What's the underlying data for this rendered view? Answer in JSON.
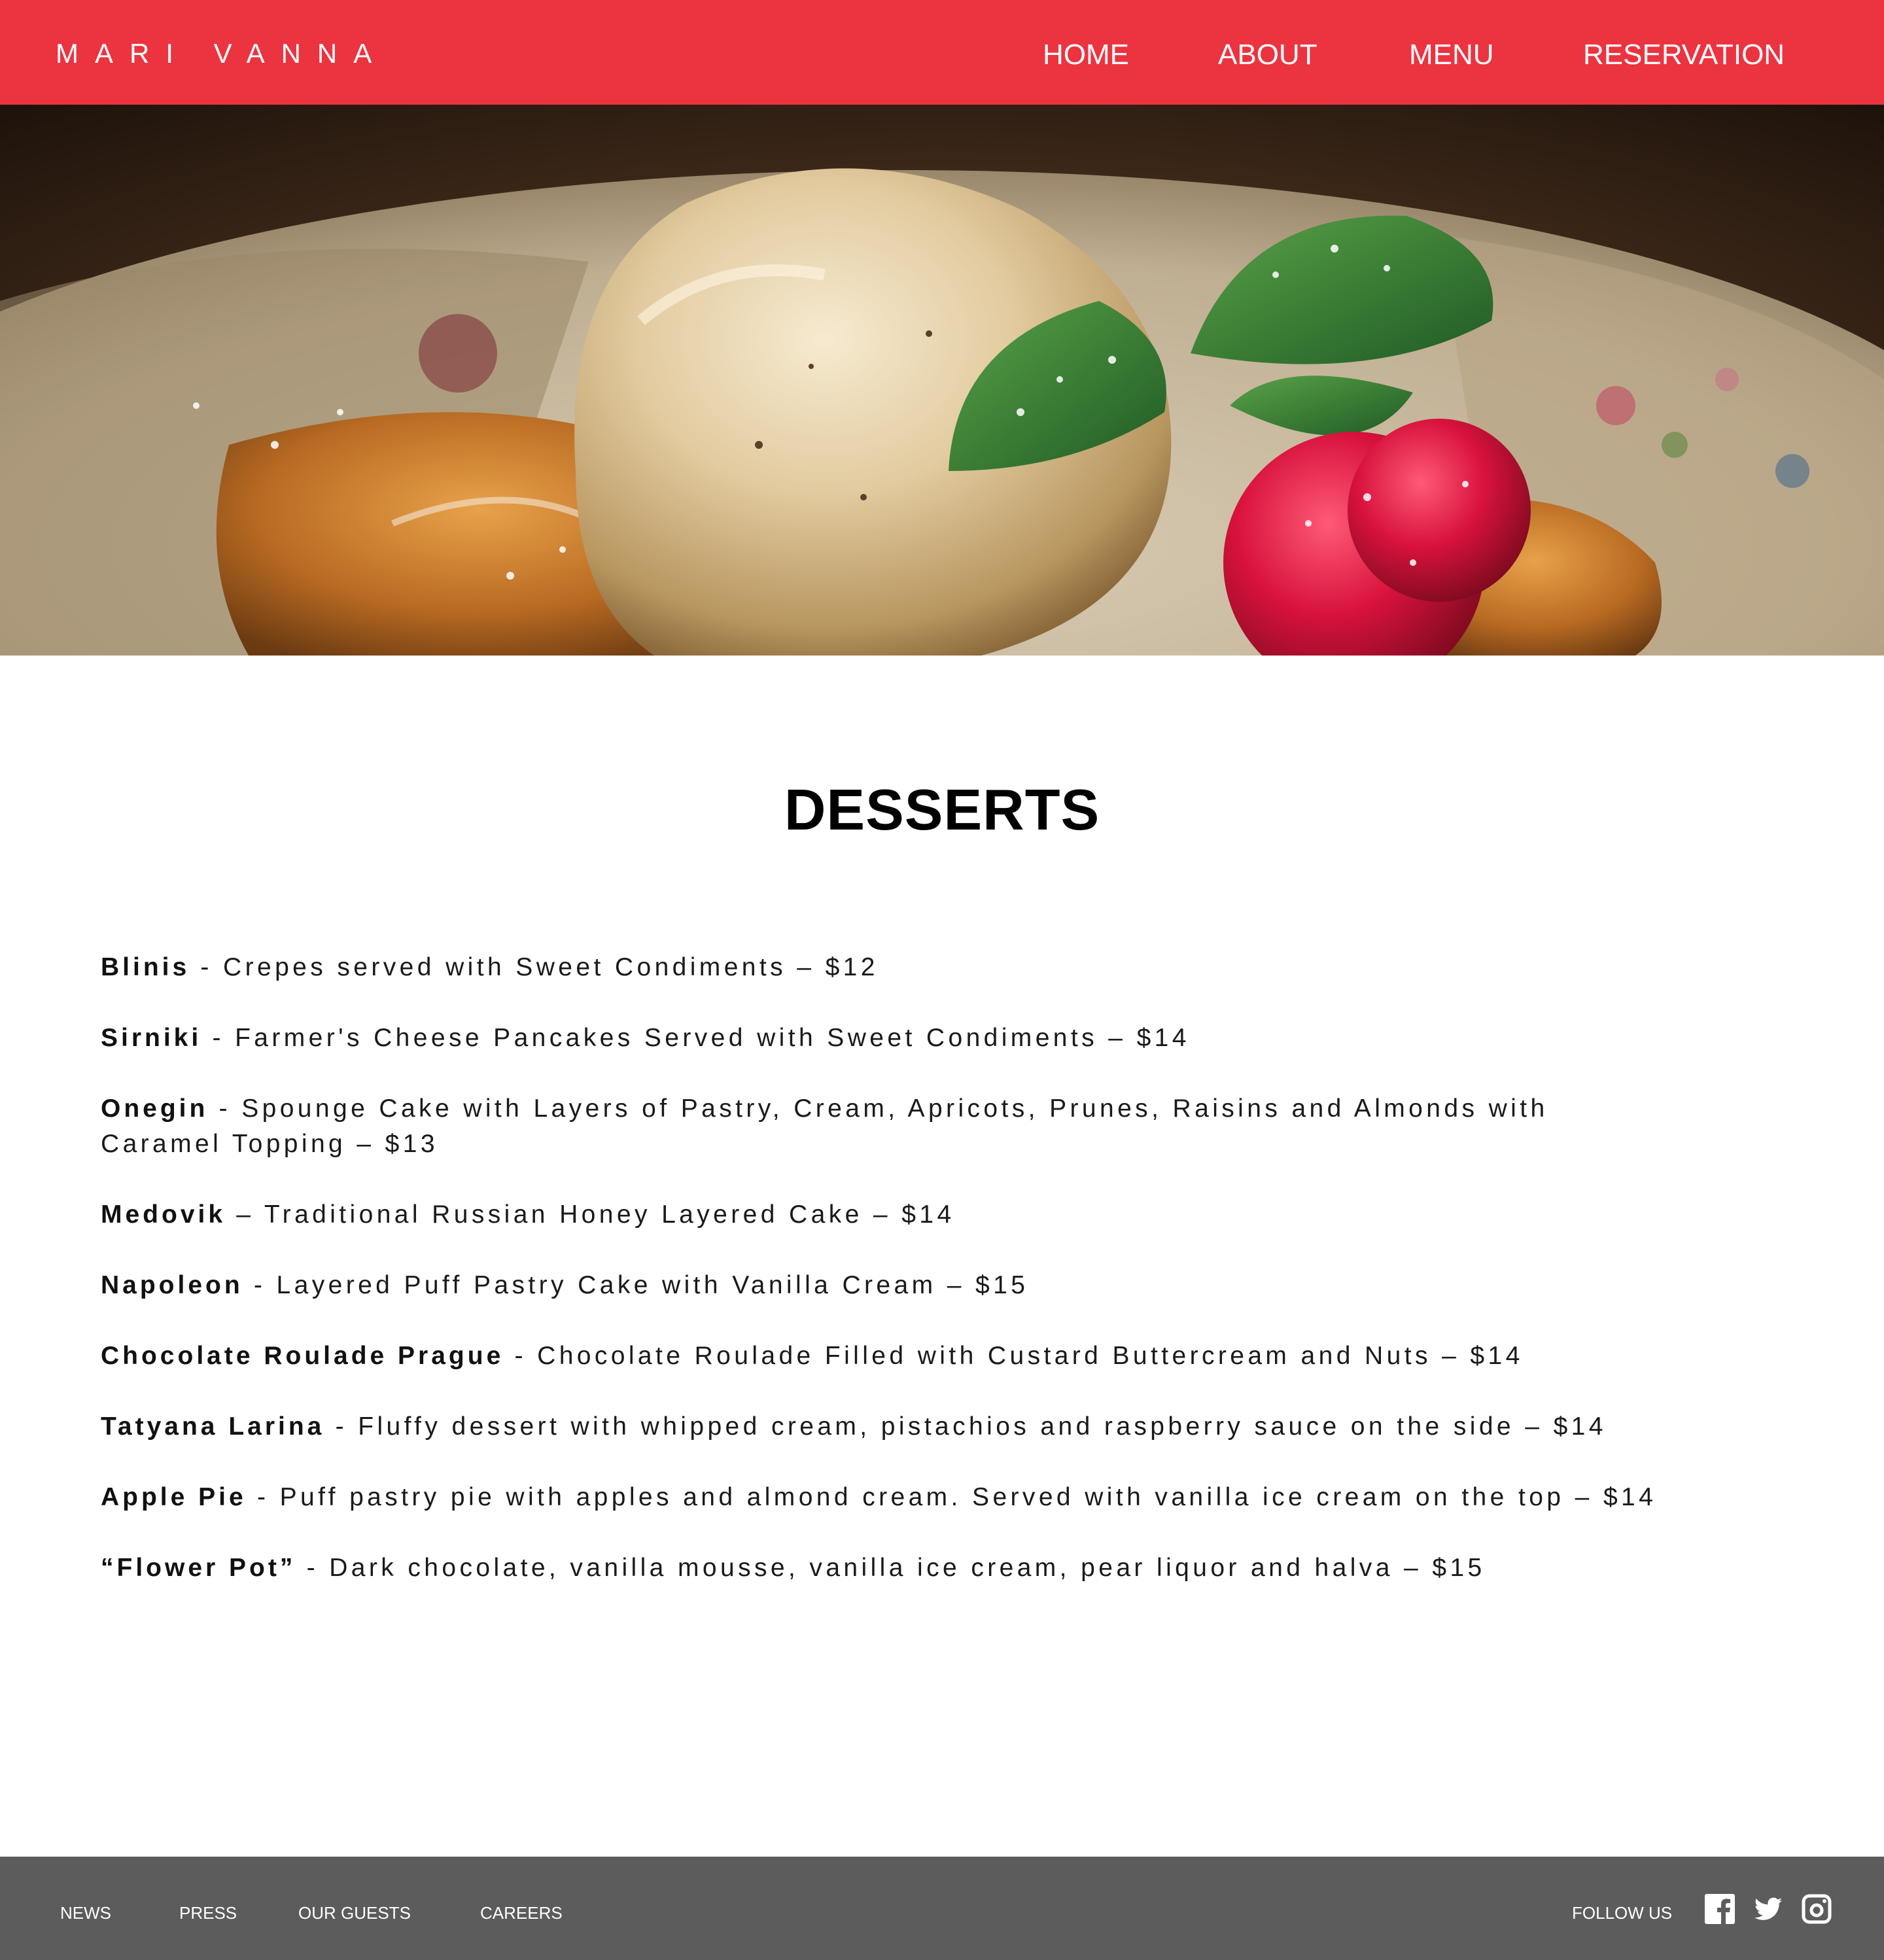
{
  "header": {
    "logo": "MARI VANNA",
    "nav": [
      {
        "label": "HOME"
      },
      {
        "label": "ABOUT"
      },
      {
        "label": "MENU"
      },
      {
        "label": "RESERVATION"
      }
    ]
  },
  "hero": {
    "image_subject": "ice cream dessert with raspberries and mint"
  },
  "main": {
    "title": "DESSERTS",
    "items": [
      {
        "name": "Blinis",
        "desc": " - Crepes served with Sweet Condiments – $12"
      },
      {
        "name": "Sirniki",
        "desc": " - Farmer's Cheese Pancakes Served with Sweet Condiments – $14"
      },
      {
        "name": "Onegin",
        "desc": " - Spounge Cake with Layers of Pastry, Cream, Apricots, Prunes, Raisins and Almonds with Caramel Topping – $13"
      },
      {
        "name": "Medovik",
        "desc": " – Traditional Russian Honey Layered Cake – $14"
      },
      {
        "name": "Napoleon",
        "desc": " - Layered Puff Pastry Cake with Vanilla Cream – $15"
      },
      {
        "name": "Chocolate Roulade Prague",
        "desc": " - Chocolate Roulade Filled with Custard Buttercream and Nuts – $14"
      },
      {
        "name": "Tatyana Larina",
        "desc": " - Fluffy dessert with whipped cream, pistachios and raspberry sauce on the side – $14"
      },
      {
        "name": "Apple Pie",
        "desc": " - Puff pastry pie with apples and almond cream. Served with vanilla ice cream on the top – $14"
      },
      {
        "name": "“Flower Pot”",
        "desc": " - Dark chocolate, vanilla mousse, vanilla ice cream, pear liquor and halva – $15"
      }
    ]
  },
  "footer": {
    "links": [
      {
        "label": "NEWS"
      },
      {
        "label": "PRESS"
      },
      {
        "label": "OUR GUESTS"
      },
      {
        "label": "CAREERS"
      }
    ],
    "follow_label": "FOLLOW US",
    "social": [
      "facebook-icon",
      "twitter-icon",
      "instagram-icon"
    ]
  },
  "colors": {
    "brand_red": "#ec3340",
    "footer_gray": "#5c5c5c",
    "text": "#111111"
  }
}
